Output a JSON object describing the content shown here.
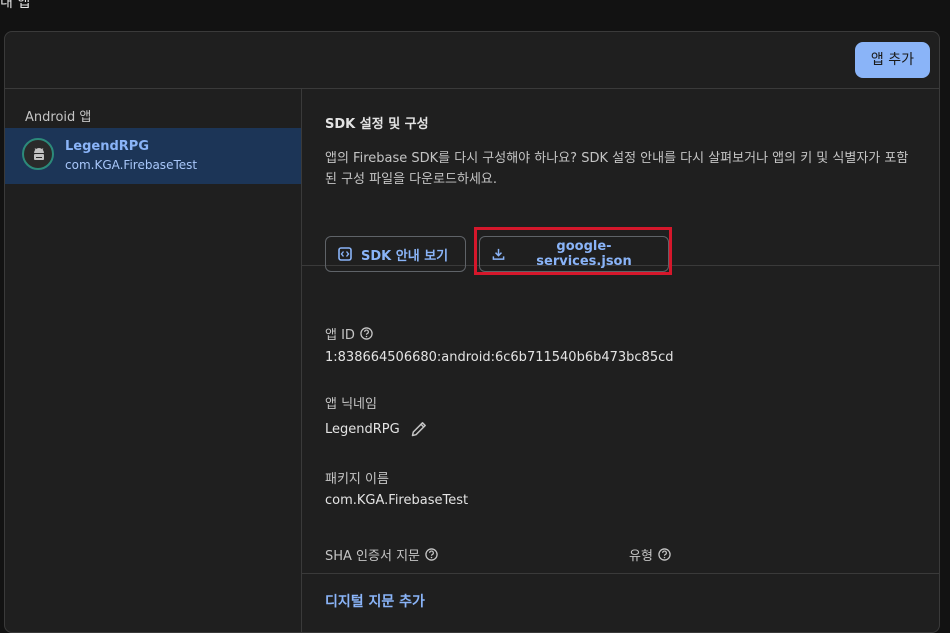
{
  "page": {
    "title": "내 앱"
  },
  "header": {
    "add_app_label": "앱 추가"
  },
  "sidebar": {
    "heading": "Android 앱",
    "apps": [
      {
        "name": "LegendRPG",
        "package": "com.KGA.FirebaseTest",
        "icon": "android-icon"
      }
    ]
  },
  "sdk": {
    "title": "SDK 설정 및 구성",
    "description": "앱의 Firebase SDK를 다시 구성해야 하나요? SDK 설정 안내를 다시 살펴보거나 앱의 키 및 식별자가 포함된 구성 파일을 다운로드하세요.",
    "guide_button_label": "SDK 안내 보기",
    "download_button_label": "google-services.json"
  },
  "details": {
    "app_id_label": "앱 ID",
    "app_id_value": "1:838664506680:android:6c6b711540b6b473bc85cd",
    "nickname_label": "앱 닉네임",
    "nickname_value": "LegendRPG",
    "package_label": "패키지 이름",
    "package_value": "com.KGA.FirebaseTest",
    "sha_label": "SHA 인증서 지문",
    "type_label": "유형",
    "add_fingerprint_label": "디지털 지문 추가"
  },
  "colors": {
    "accent": "#8ab4f8",
    "selected_bg": "#1c3557",
    "highlight": "#d5172b"
  }
}
